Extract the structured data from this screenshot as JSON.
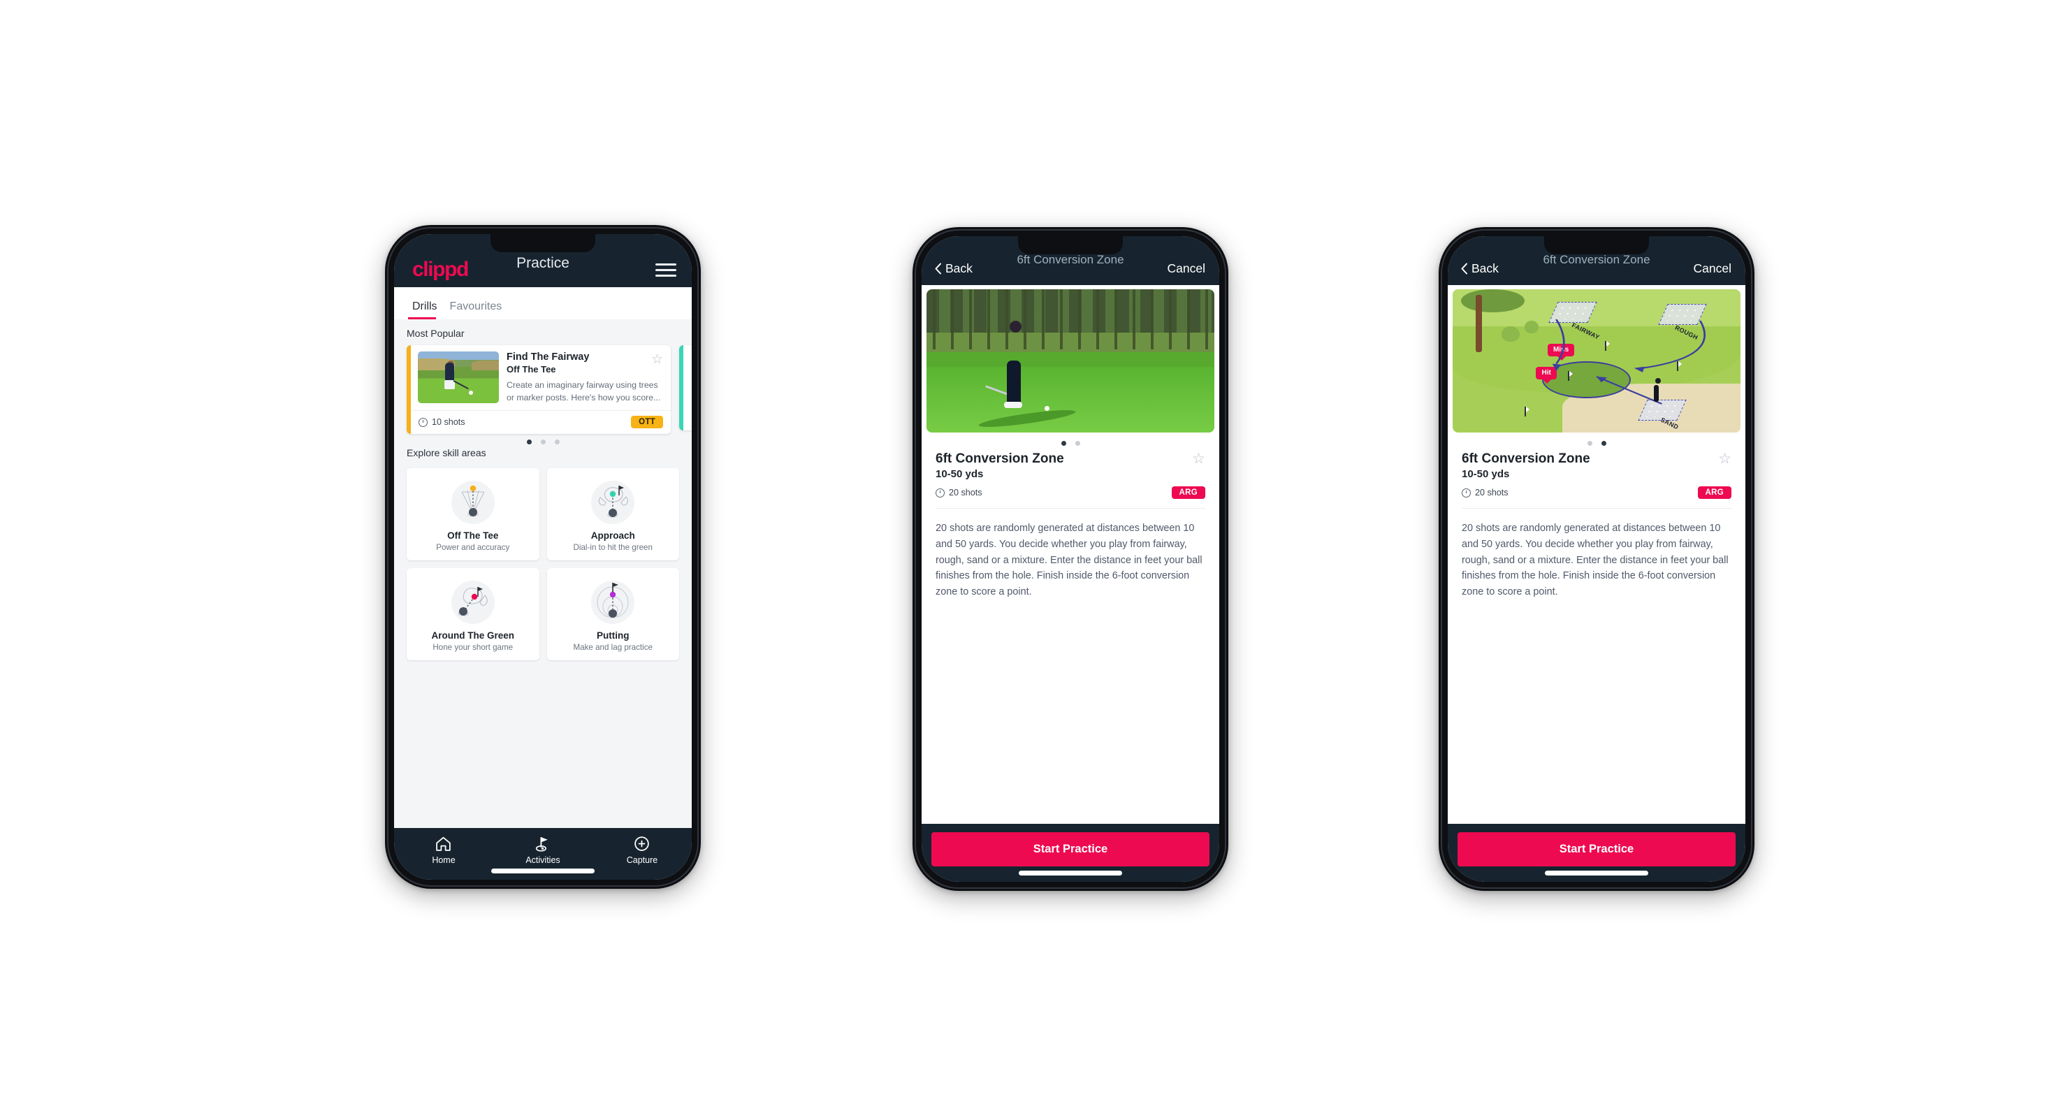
{
  "phone1": {
    "header": {
      "logo": "clippd",
      "title": "Practice",
      "menu_icon": "hamburger-menu-icon"
    },
    "tabs": [
      {
        "label": "Drills",
        "active": true
      },
      {
        "label": "Favourites",
        "active": false
      }
    ],
    "most_popular": {
      "section_label": "Most Popular",
      "card": {
        "name": "Find The Fairway",
        "skill": "Off The Tee",
        "description": "Create an imaginary fairway using trees or marker posts. Here's how you score...",
        "shots": "10 shots",
        "badge": "OTT",
        "badge_color": "#f7b215",
        "accent_color": "#f5b01a",
        "star_icon": "star-outline-icon"
      },
      "dots": [
        true,
        false,
        false
      ]
    },
    "skill_areas": {
      "section_label": "Explore skill areas",
      "items": [
        {
          "name": "Off The Tee",
          "desc": "Power and accuracy",
          "accent": "#f5b01a"
        },
        {
          "name": "Approach",
          "desc": "Dial-in to hit the green",
          "accent": "#2fd6ae"
        },
        {
          "name": "Around The Green",
          "desc": "Hone your short game",
          "accent": "#ed0a51"
        },
        {
          "name": "Putting",
          "desc": "Make and lag practice",
          "accent": "#b32fd6"
        }
      ]
    },
    "bottom_nav": [
      {
        "label": "Home",
        "icon": "home-icon"
      },
      {
        "label": "Activities",
        "icon": "golf-flag-icon"
      },
      {
        "label": "Capture",
        "icon": "plus-circle-icon"
      }
    ]
  },
  "detail": {
    "header": {
      "back": "Back",
      "title": "6ft Conversion Zone",
      "cancel": "Cancel",
      "back_icon": "chevron-left-icon"
    },
    "title": "6ft Conversion Zone",
    "yards": "10-50 yds",
    "shots": "20 shots",
    "badge": "ARG",
    "badge_color": "#ed0a51",
    "star_icon": "star-outline-icon",
    "description": "20 shots are randomly generated at distances between 10 and 50 yards. You decide whether you play from fairway, rough, sand or a mixture. Enter the distance in feet your ball finishes from the hole. Finish inside the 6-foot conversion zone to score a point.",
    "cta": "Start Practice",
    "dots_photo": [
      true,
      false
    ],
    "dots_illus": [
      false,
      true
    ]
  },
  "illustration": {
    "zones": [
      "FAIRWAY",
      "ROUGH",
      "SAND"
    ],
    "tags": [
      "Miss",
      "Hit"
    ]
  },
  "colors": {
    "brand_pink": "#ed0a51",
    "dark_navy": "#17242f",
    "amber": "#f7b215",
    "teal": "#3ad6b5"
  }
}
